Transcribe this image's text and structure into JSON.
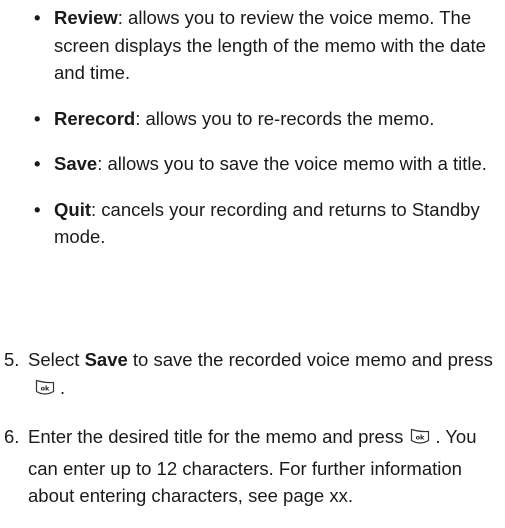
{
  "options": [
    {
      "term": "Review",
      "text": ": allows you to review the voice memo. The screen displays the length of the memo with the date and time."
    },
    {
      "term": "Rerecord",
      "text": ": allows you to re-records the memo."
    },
    {
      "term": "Save",
      "text": ": allows you to save the voice memo with a title."
    },
    {
      "term": "Quit",
      "text": ": cancels your recording and returns to Standby mode."
    }
  ],
  "bullet_glyph": "•",
  "steps": [
    {
      "number": "5.",
      "before": "Select ",
      "bold": "Save",
      "after": " to save the recorded voice memo and press",
      "end": "."
    },
    {
      "number": "6.",
      "before": "Enter the desired title for the memo and press",
      "end": ". You can enter up to 12 characters. For further information about entering characters, see page xx."
    }
  ],
  "icons": {
    "ok_key": "ok-key-icon",
    "ok_key_label": "ok"
  }
}
